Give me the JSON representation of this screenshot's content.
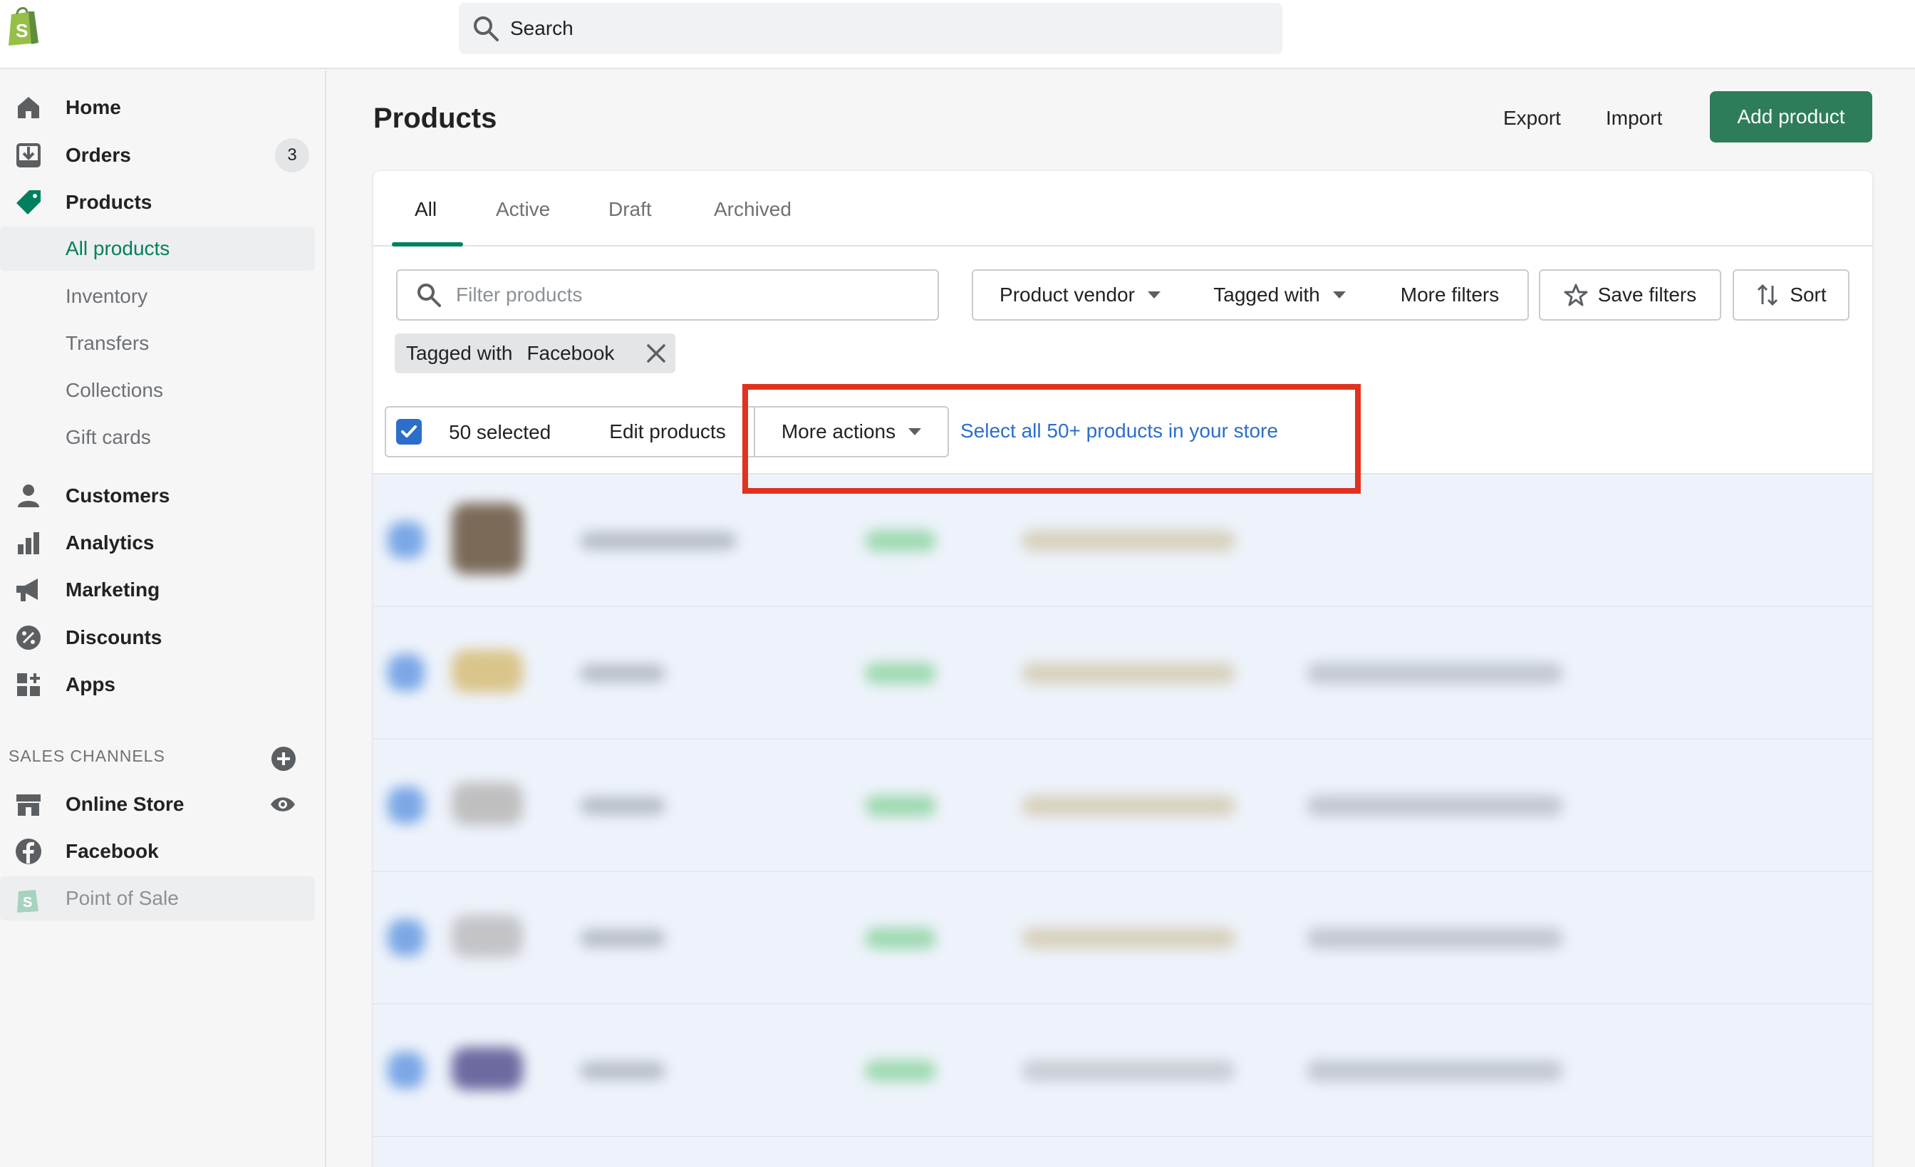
{
  "topbar": {
    "search_label": "Search"
  },
  "sidebar": {
    "items": [
      {
        "label": "Home",
        "icon": "home-icon"
      },
      {
        "label": "Orders",
        "icon": "orders-icon",
        "badge": "3"
      },
      {
        "label": "Products",
        "icon": "tag-icon"
      },
      {
        "label": "All products"
      },
      {
        "label": "Inventory"
      },
      {
        "label": "Transfers"
      },
      {
        "label": "Collections"
      },
      {
        "label": "Gift cards"
      },
      {
        "label": "Customers",
        "icon": "person-icon"
      },
      {
        "label": "Analytics",
        "icon": "bar-chart-icon"
      },
      {
        "label": "Marketing",
        "icon": "megaphone-icon"
      },
      {
        "label": "Discounts",
        "icon": "discount-icon"
      },
      {
        "label": "Apps",
        "icon": "apps-icon"
      }
    ],
    "sales_channels_title": "SALES CHANNELS",
    "channels": [
      {
        "label": "Online Store",
        "icon": "store-icon"
      },
      {
        "label": "Facebook",
        "icon": "facebook-icon"
      },
      {
        "label": "Point of Sale",
        "icon": "shopify-bag-icon"
      }
    ]
  },
  "page": {
    "title": "Products",
    "export_label": "Export",
    "import_label": "Import",
    "add_label": "Add product"
  },
  "tabs": [
    "All",
    "Active",
    "Draft",
    "Archived"
  ],
  "filters": {
    "placeholder": "Filter products",
    "vendor_label": "Product vendor",
    "tagged_label": "Tagged with",
    "more_label": "More filters",
    "save_label": "Save filters",
    "sort_label": "Sort"
  },
  "applied_tag": {
    "prefix": "Tagged with",
    "value": "Facebook"
  },
  "bulk": {
    "selected_label": "50 selected",
    "edit_label": "Edit products",
    "more_actions_label": "More actions",
    "select_all_label": "Select all 50+ products in your store"
  },
  "colors": {
    "accent": "#008060",
    "primary_button": "#2e7d5a",
    "link": "#2c6ecb",
    "highlight": "#e0321f"
  }
}
